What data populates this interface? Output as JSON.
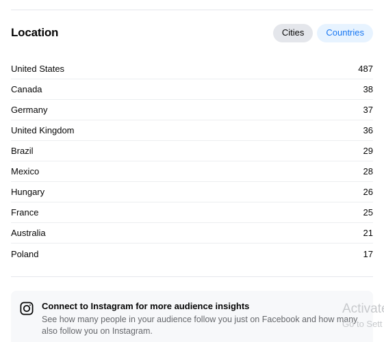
{
  "section": {
    "title": "Location"
  },
  "toggle": {
    "options": [
      {
        "label": "Cities",
        "active": false
      },
      {
        "label": "Countries",
        "active": true
      }
    ],
    "inactive_bg": "#e4e6eb",
    "active_bg": "#e7f3ff",
    "active_color": "#1877f2"
  },
  "list": {
    "rows": [
      {
        "label": "United States",
        "value": "487"
      },
      {
        "label": "Canada",
        "value": "38"
      },
      {
        "label": "Germany",
        "value": "37"
      },
      {
        "label": "United Kingdom",
        "value": "36"
      },
      {
        "label": "Brazil",
        "value": "29"
      },
      {
        "label": "Mexico",
        "value": "28"
      },
      {
        "label": "Hungary",
        "value": "26"
      },
      {
        "label": "France",
        "value": "25"
      },
      {
        "label": "Australia",
        "value": "21"
      },
      {
        "label": "Poland",
        "value": "17"
      }
    ]
  },
  "promo": {
    "icon": "instagram-icon",
    "title": "Connect to Instagram for more audience insights",
    "subtitle": "See how many people in your audience follow you just on Facebook and how many also follow you on Instagram."
  },
  "watermark": {
    "line1": "Activate",
    "line2": "Go to Sett"
  }
}
